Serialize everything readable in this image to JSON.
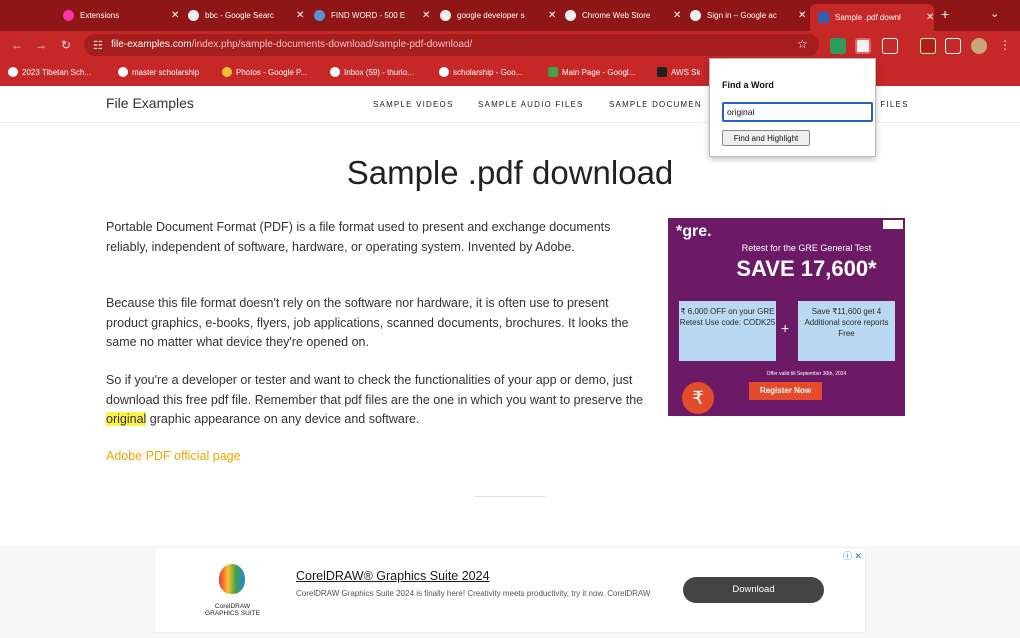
{
  "browser": {
    "tabs": [
      {
        "title": "Extensions",
        "active": false
      },
      {
        "title": "bbc - Google Searc",
        "active": false
      },
      {
        "title": "FIND WORD - 500 E",
        "active": false
      },
      {
        "title": "google developer s",
        "active": false
      },
      {
        "title": "Chrome Web Store",
        "active": false
      },
      {
        "title": "Sign in – Google ac",
        "active": false
      },
      {
        "title": "Sample .pdf downl",
        "active": true
      }
    ],
    "new_tab_icon": "+",
    "tab_menu_icon": "⌄",
    "back_icon": "←",
    "forward_icon": "→",
    "reload_icon": "↻",
    "url_domain": "file-examples.com",
    "url_path": "/index.php/sample-documents-download/sample-pdf-download/",
    "star_icon": "☆",
    "bookmarks": [
      "2023 Tibetan Sch...",
      "master scholarship",
      "Photos - Google P...",
      "Inbox (59) - thurio...",
      "scholarship - Goo...",
      "Main Page - Googl...",
      "AWS Sk"
    ],
    "colors": {
      "frame": "#8f1616",
      "toolbar": "#c62828"
    }
  },
  "site": {
    "logo": "File Examples",
    "menu": [
      "SAMPLE VIDEOS",
      "SAMPLE AUDIO FILES",
      "SAMPLE DOCUMEN",
      "R FILES"
    ]
  },
  "main": {
    "title": "Sample .pdf download",
    "p1": "Portable Document Format (PDF) is a file format used to present and exchange documents reliably, independent of software, hardware, or operating system. Invented by Adobe.",
    "p2": "Because this file format doesn't rely on the software nor hardware, it is often use to present product graphics, e-books, flyers, job applications, scanned documents, brochures. It looks the same no matter what device they're opened on.",
    "p3_before": "So if you're a developer or tester and want to check the functionalities of your app or demo, just download this free pdf file. Remember that pdf files are the one in which you want to preserve the ",
    "p3_highlight": "original",
    "p3_after": " graphic appearance on any device and software.",
    "link": "Adobe PDF official page",
    "highlight_color": "#fff14b",
    "link_color": "#f0a500"
  },
  "gre_ad": {
    "logo": "*gre.",
    "retest": "Retest for the GRE General Test",
    "save": "SAVE 17,600*",
    "box1": "₹ 6,000 OFF on your GRE Retest Use code: CODK25",
    "plus": "+",
    "box2": "Save ₹11,600 get 4 Additional score reports Free",
    "valid": "Offer valid till September 30th, 2024",
    "register": "Register Now",
    "rupee": "₹",
    "background": "#6d1a66"
  },
  "bottom_ad": {
    "logo_text": "CorelDRAW GRAPHICS SUITE",
    "title": "CorelDRAW® Graphics Suite 2024",
    "desc": "CorelDRAW Graphics Suite 2024 is finally here! Creativity meets productivity, try it now. CorelDRAW",
    "button": "Download",
    "adchoices": "ⓘ ✕"
  },
  "popup": {
    "heading": "Find a Word",
    "input_value": "original",
    "button": "Find and Highlight"
  }
}
